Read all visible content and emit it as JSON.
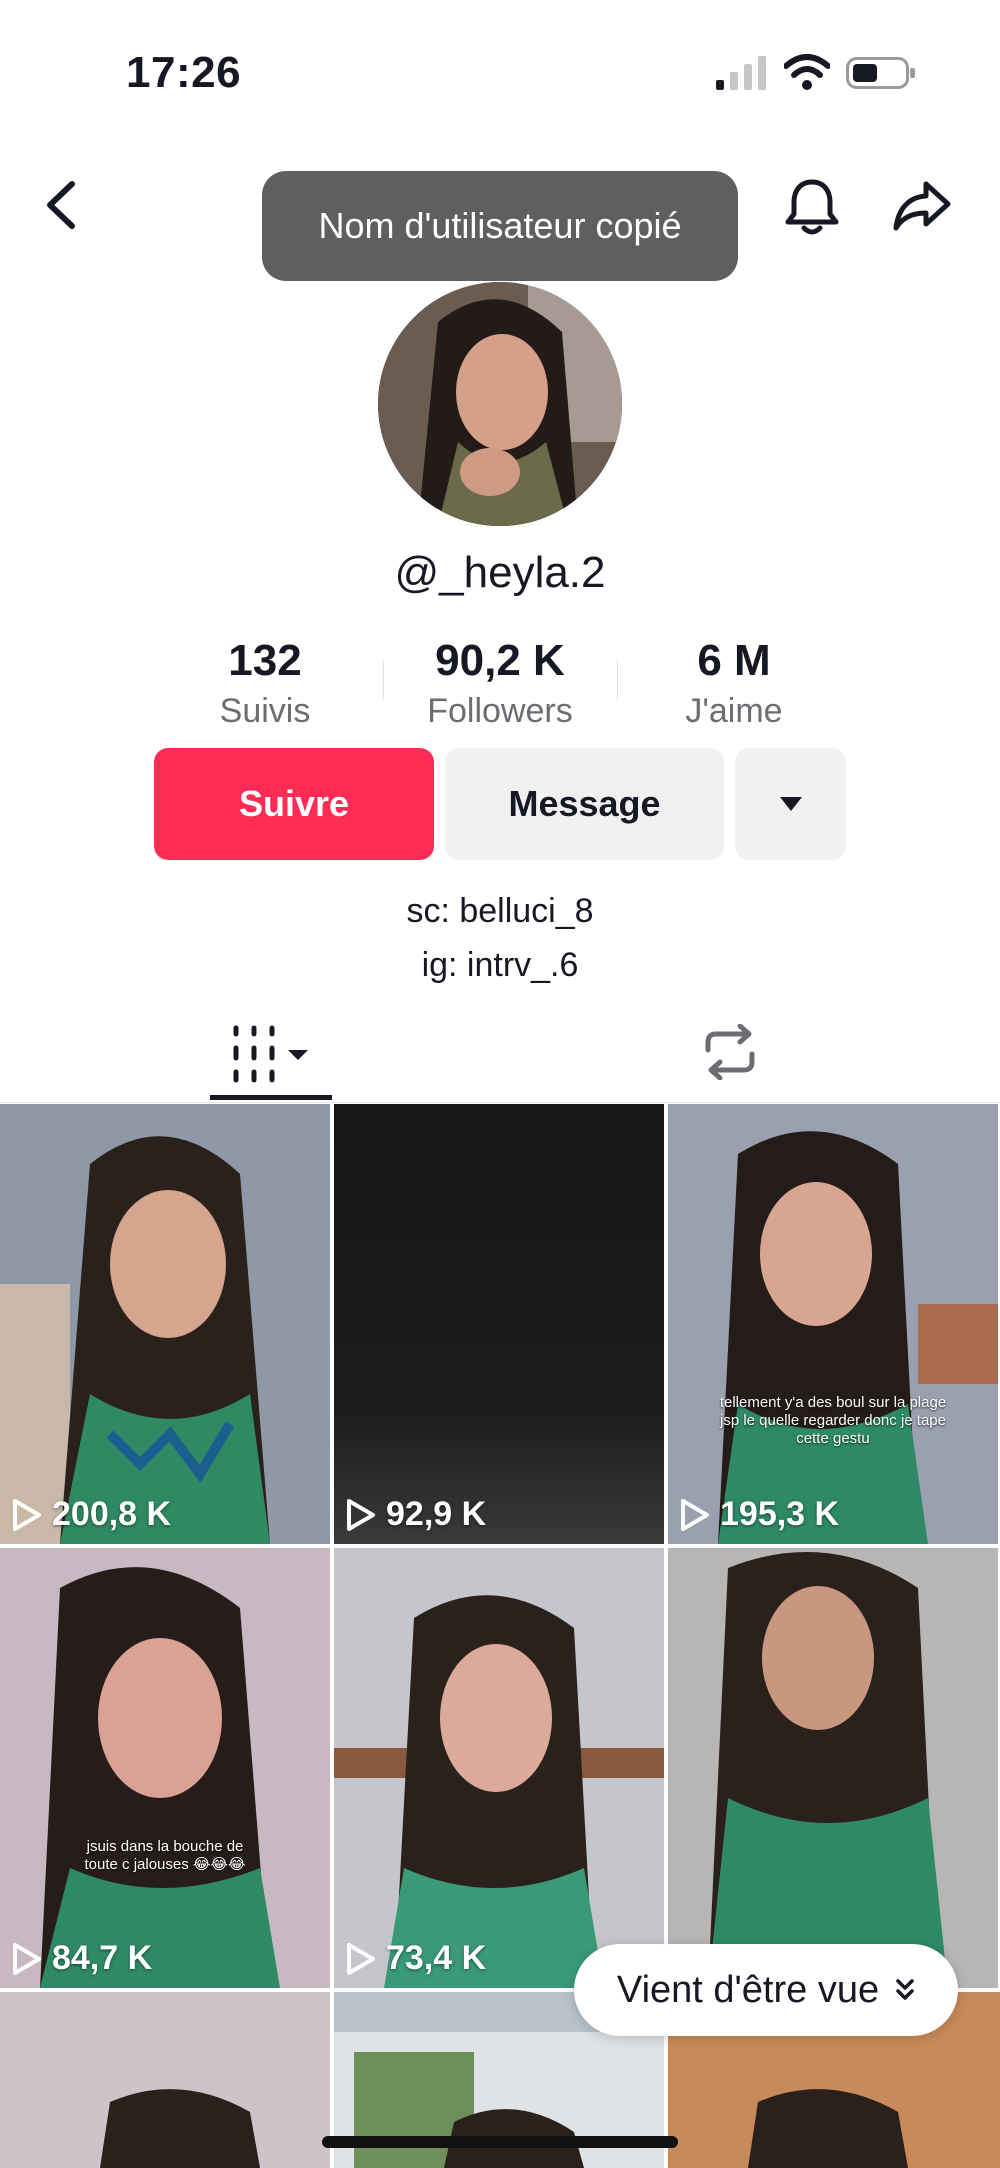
{
  "status_bar": {
    "time": "17:26"
  },
  "header": {
    "toast": "Nom d'utilisateur copié"
  },
  "profile": {
    "username": "@_heyla.2",
    "stats": [
      {
        "value": "132",
        "label": "Suivis"
      },
      {
        "value": "90,2 K",
        "label": "Followers"
      },
      {
        "value": "6 M",
        "label": "J'aime"
      }
    ],
    "follow_label": "Suivre",
    "message_label": "Message",
    "bio": [
      "sc: belluci_8",
      "ig: intrv_.6"
    ]
  },
  "videos": [
    {
      "views": "200,8 K",
      "caption": ""
    },
    {
      "views": "92,9 K",
      "caption": ""
    },
    {
      "views": "195,3 K",
      "caption": "tellement y'a des boul sur la plage jsp le quelle regarder donc je tape cette gestu"
    },
    {
      "views": "84,7 K",
      "caption": "jsuis dans la bouche de toute c jalouses 😂😂😂"
    },
    {
      "views": "73,4 K",
      "caption": ""
    },
    {
      "views": "",
      "caption": ""
    }
  ],
  "recently_viewed_label": "Vient d'être vue",
  "colors": {
    "accent": "#fe2c55",
    "secondary_button": "#f1f1f2",
    "text": "#161823",
    "muted": "#6c6d72"
  }
}
